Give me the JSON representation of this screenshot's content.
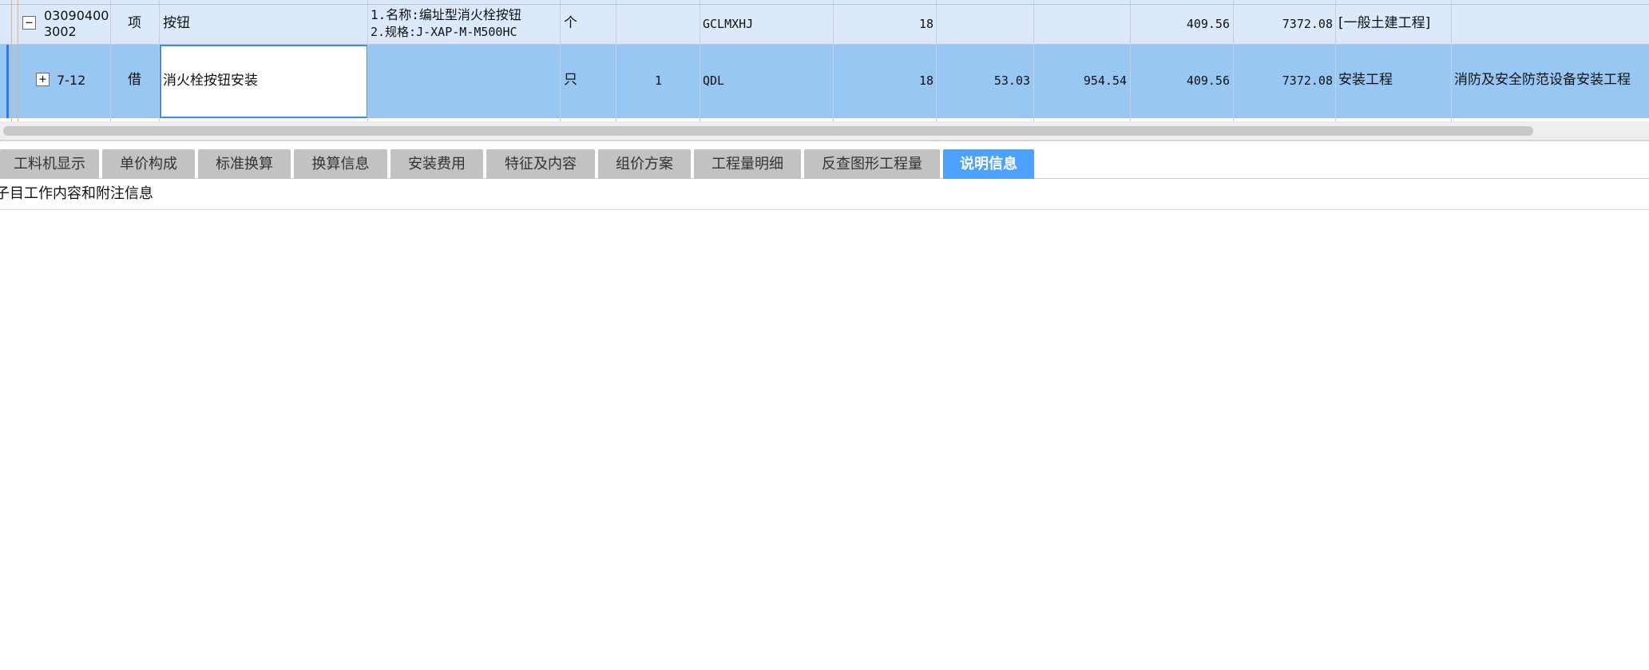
{
  "grid": {
    "row1": {
      "code_line1": "03090400",
      "code_line2": "3002",
      "type": "项",
      "name": "按钮",
      "feature_line1": "1.名称:编址型消火栓按钮",
      "feature_line2": "2.规格:J-XAP-M-M500HC",
      "unit": "个",
      "qty_expr": "GCLMXHJ",
      "qty": "18",
      "price": "409.56",
      "total": "7372.08",
      "category": "[一般土建工程]",
      "expander": "−"
    },
    "row2": {
      "code": "7-12",
      "type": "借",
      "name": "消火栓按钮安装",
      "unit": "只",
      "content": "1",
      "qty_expr": "QDL",
      "qty": "18",
      "unit_price": "53.03",
      "amount": "954.54",
      "price": "409.56",
      "total": "7372.08",
      "category": "安装工程",
      "specialty": "消防及安全防范设备安装工程",
      "expander": "+"
    }
  },
  "tabs": [
    {
      "label": "工料机显示",
      "active": false
    },
    {
      "label": "单价构成",
      "active": false
    },
    {
      "label": "标准换算",
      "active": false
    },
    {
      "label": "换算信息",
      "active": false
    },
    {
      "label": "安装费用",
      "active": false
    },
    {
      "label": "特征及内容",
      "active": false
    },
    {
      "label": "组价方案",
      "active": false
    },
    {
      "label": "工程量明细",
      "active": false
    },
    {
      "label": "反查图形工程量",
      "active": false
    },
    {
      "label": "说明信息",
      "active": true
    }
  ],
  "info": {
    "text": "子目工作内容和附注信息"
  },
  "colors": {
    "selected_row": "#99c7f3",
    "parent_row": "#dce9fb",
    "active_tab": "#4da1ff",
    "inactive_tab": "#c2c2c2"
  }
}
